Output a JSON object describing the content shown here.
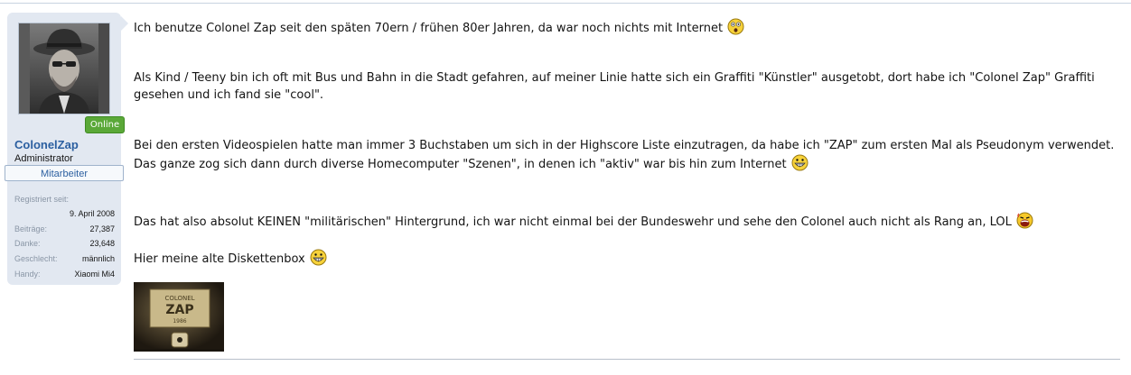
{
  "user": {
    "online_label": "Online",
    "username": "ColonelZap",
    "title": "Administrator",
    "banner": "Mitarbeiter",
    "extras": [
      {
        "label": "Registriert seit:",
        "value": "9. April 2008"
      },
      {
        "label": "Beiträge:",
        "value": "27,387"
      },
      {
        "label": "Danke:",
        "value": "23,648"
      },
      {
        "label": "Geschlecht:",
        "value": "männlich"
      },
      {
        "label": "Handy:",
        "value": "Xiaomi Mi4"
      }
    ]
  },
  "post": {
    "paragraphs": [
      {
        "lines": [
          "Ich benutze Colonel Zap seit den späten 70ern / frühen 80er Jahren, da war noch nichts mit Internet"
        ],
        "smiley": "eek-smiley-icon"
      },
      {
        "lines": [
          "Als Kind / Teeny bin ich oft mit Bus und Bahn in die Stadt gefahren, auf meiner Linie hatte sich ein Graffiti \"Künstler\" ausgetobt, dort habe ich \"Colonel Zap\" Graffiti",
          "gesehen und ich fand sie \"cool\"."
        ]
      },
      {
        "lines": [
          "Bei den ersten Videospielen hatte man immer 3 Buchstaben um sich in der Highscore Liste einzutragen, da habe ich \"ZAP\" zum ersten Mal als Pseudonym verwendet.",
          "Das ganze zog sich dann durch diverse Homecomputer \"Szenen\", in denen ich \"aktiv\" war bis hin zum Internet"
        ],
        "smiley": "grin-smiley-icon"
      },
      {
        "lines": [
          "Das hat also absolut KEINEN \"militärischen\" Hintergrund, ich war nicht einmal bei der Bundeswehr und sehe den Colonel auch nicht als Rang an, LOL"
        ],
        "smiley": "laugh-smiley-icon"
      },
      {
        "lines": [
          "Hier meine alte Diskettenbox"
        ],
        "smiley": "grin-smiley-icon"
      }
    ],
    "image_text": {
      "line1": "COLONEL",
      "line2": "ZAP",
      "line3": "1986"
    }
  },
  "colors": {
    "sidebar_bg": "#e2e8f1",
    "username": "#2b5fa0",
    "online_badge": "#5aa838"
  }
}
